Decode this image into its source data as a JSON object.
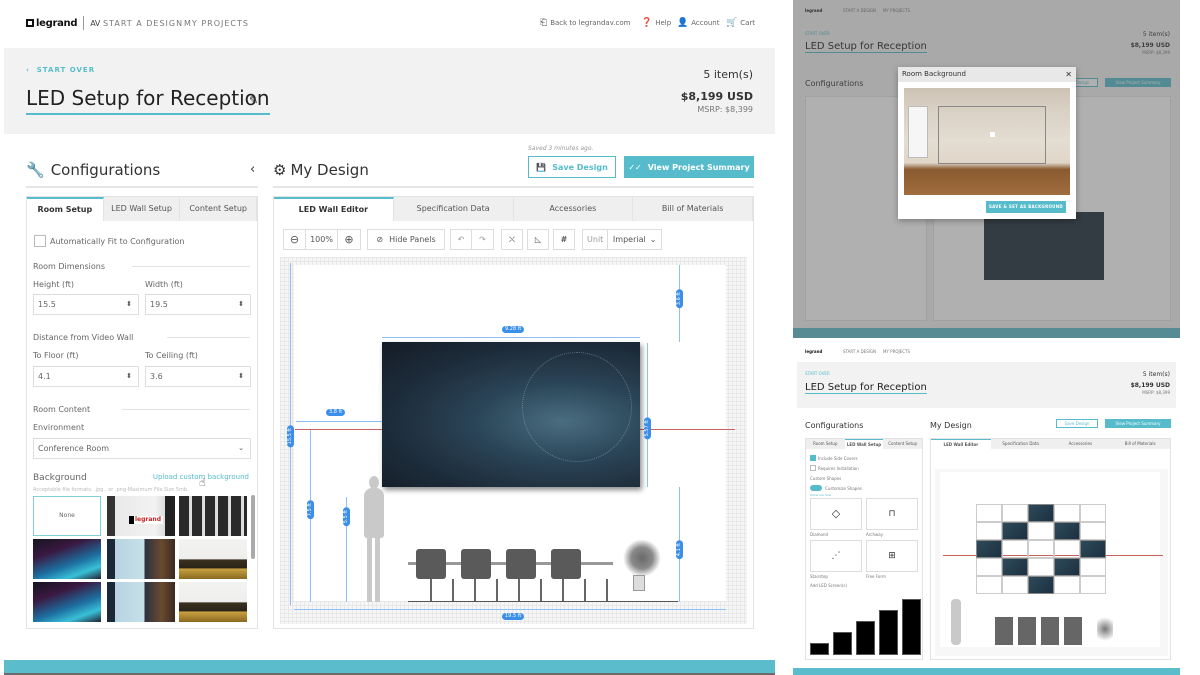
{
  "nav": {
    "logo": "legrand",
    "logo_suffix": "AV",
    "links": [
      "START A DESIGN",
      "MY PROJECTS"
    ],
    "right_links": [
      {
        "icon": "exit-icon",
        "label": "Back to legrandav.com"
      },
      {
        "icon": "help-icon",
        "label": "Help"
      },
      {
        "icon": "user-icon",
        "label": "Account"
      },
      {
        "icon": "cart-icon",
        "label": "Cart"
      }
    ]
  },
  "project": {
    "start_over": "START OVER",
    "title": "LED Setup for Reception",
    "items": "5 item(s)",
    "price": "$8,199 USD",
    "msrp": "MSRP: $8,399"
  },
  "configurations": {
    "title": "Configurations",
    "tabs": [
      "Room Setup",
      "LED Wall Setup",
      "Content Setup"
    ],
    "active_tab": "Room Setup",
    "auto_fit_label": "Automatically Fit to Configuration",
    "auto_fit_checked": false,
    "room_dimensions": {
      "section": "Room Dimensions",
      "height_label": "Height (ft)",
      "height_value": "15.5",
      "width_label": "Width (ft)",
      "width_value": "19.5"
    },
    "distance": {
      "section": "Distance from Video Wall",
      "floor_label": "To Floor (ft)",
      "floor_value": "4.1",
      "ceiling_label": "To Ceiling (ft)",
      "ceiling_value": "3.6"
    },
    "room_content": {
      "section": "Room Content",
      "environment_label": "Environment",
      "environment_value": "Conference Room"
    },
    "background": {
      "label": "Background",
      "upload_link": "Upload custom background",
      "hint": "Acceptable file formats: .jpg., or .png-Maximum File Size 5mb.",
      "none_label": "None",
      "thumbnails": [
        "None",
        "Legrand lobby",
        "Bookshelf",
        "Neon stage",
        "Poster hallway",
        "Auditorium",
        "Neon stage",
        "Poster hallway",
        "Auditorium"
      ]
    }
  },
  "design": {
    "title": "My Design",
    "saved_text": "Saved 3 minutes ago.",
    "save_button": "Save Design",
    "summary_button": "View Project Summary",
    "tabs": [
      "LED Wall Editor",
      "Specification Data",
      "Accessories",
      "Bill of Materials"
    ],
    "active_tab": "LED Wall Editor",
    "toolbar": {
      "zoom": "100%",
      "hide_panels": "Hide Panels",
      "unit_label": "Unit",
      "unit_value": "Imperial"
    },
    "dimensions": {
      "screen_width": "9.28 ft",
      "left_offset": "3.8 ft",
      "room_height": "15.5 ft",
      "horizon_height": "7.5 ft",
      "person_height": "5.5 ft",
      "screen_height": "5.57 ft",
      "to_ceiling": "3.6 ft",
      "to_floor": "4.1 ft",
      "room_width": "19.5 ft"
    }
  },
  "preview_top": {
    "modal_title": "Room Background",
    "modal_button": "SAVE & SET AS BACKGROUND"
  },
  "preview_bottom": {
    "active_tab": "LED Wall Setup",
    "include_side_covers": "Include Side Covers",
    "include_side_covers_checked": true,
    "requires_installation": "Requires Installation",
    "custom_shapes": "Custom Shapes",
    "customize_shapes": "Customize Shapes",
    "customize_on": true,
    "show_me_how": "Show me how",
    "shapes": [
      "Diamond",
      "Archway",
      "Stairstep",
      "Free Form"
    ],
    "selected_shape": "Diamond",
    "add_screens_label": "Add LED Screen(s)",
    "screen_stacks": [
      1,
      2,
      3,
      4,
      5
    ]
  },
  "colors": {
    "accent": "#56bccc",
    "dimension": "#3c8fe8",
    "horizon": "#c96060"
  }
}
